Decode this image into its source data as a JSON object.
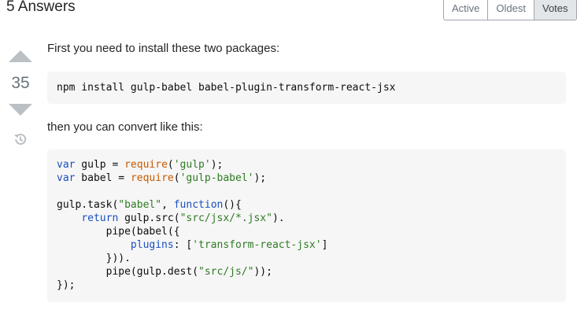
{
  "header": {
    "answers_count_title": "5 Answers",
    "sort_tabs": [
      {
        "label": "Active",
        "selected": false
      },
      {
        "label": "Oldest",
        "selected": false
      },
      {
        "label": "Votes",
        "selected": true
      }
    ]
  },
  "answer": {
    "vote_count": "35",
    "icons": {
      "upvote": "caret-up-icon",
      "downvote": "caret-down-icon",
      "history": "history-icon"
    },
    "paragraph_1": "First you need to install these two packages:",
    "command": "npm install gulp-babel babel-plugin-transform-react-jsx",
    "paragraph_2": "then you can convert like this:",
    "code_lines": [
      [
        {
          "t": "kw",
          "v": "var"
        },
        {
          "t": "pl",
          "v": " gulp = "
        },
        {
          "t": "fn",
          "v": "require"
        },
        {
          "t": "pl",
          "v": "("
        },
        {
          "t": "str",
          "v": "'gulp'"
        },
        {
          "t": "pl",
          "v": ");"
        }
      ],
      [
        {
          "t": "kw",
          "v": "var"
        },
        {
          "t": "pl",
          "v": " babel = "
        },
        {
          "t": "fn",
          "v": "require"
        },
        {
          "t": "pl",
          "v": "("
        },
        {
          "t": "str",
          "v": "'gulp-babel'"
        },
        {
          "t": "pl",
          "v": ");"
        }
      ],
      [],
      [
        {
          "t": "pl",
          "v": "gulp.task("
        },
        {
          "t": "str",
          "v": "\"babel\""
        },
        {
          "t": "pl",
          "v": ", "
        },
        {
          "t": "kw",
          "v": "function"
        },
        {
          "t": "pl",
          "v": "(){"
        }
      ],
      [
        {
          "t": "pl",
          "v": "    "
        },
        {
          "t": "kw",
          "v": "return"
        },
        {
          "t": "pl",
          "v": " gulp.src("
        },
        {
          "t": "str",
          "v": "\"src/jsx/*.jsx\""
        },
        {
          "t": "pl",
          "v": ")."
        }
      ],
      [
        {
          "t": "pl",
          "v": "        pipe(babel({"
        }
      ],
      [
        {
          "t": "pl",
          "v": "            "
        },
        {
          "t": "prop",
          "v": "plugins"
        },
        {
          "t": "pl",
          "v": ": ["
        },
        {
          "t": "str",
          "v": "'transform-react-jsx'"
        },
        {
          "t": "pl",
          "v": "]"
        }
      ],
      [
        {
          "t": "pl",
          "v": "        }))."
        }
      ],
      [
        {
          "t": "pl",
          "v": "        pipe(gulp.dest("
        },
        {
          "t": "str",
          "v": "\"src/js/\""
        },
        {
          "t": "pl",
          "v": "));"
        }
      ],
      [
        {
          "t": "pl",
          "v": "});"
        }
      ]
    ],
    "colors": {
      "keyword": "#1a4fbf",
      "string": "#2f7a24",
      "function": "#c65a00",
      "vote_arrow": "#bbc0c4"
    }
  }
}
